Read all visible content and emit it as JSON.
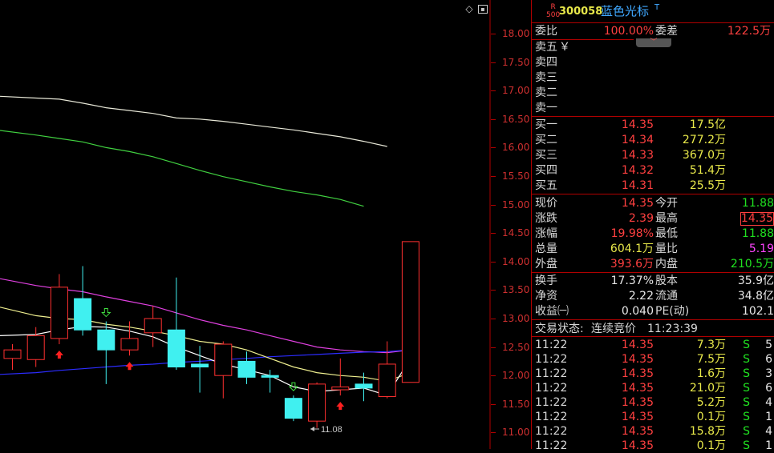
{
  "stock": {
    "badge_top": "R",
    "badge_bottom": "500",
    "code": "300058",
    "name": "蓝色光标",
    "flag": "T"
  },
  "commission": {
    "ratio_label": "委比",
    "ratio_value": "100.00%",
    "diff_label": "委差",
    "diff_value": "122.5万"
  },
  "sell": [
    {
      "label": "卖五",
      "extra": "￥"
    },
    {
      "label": "卖四"
    },
    {
      "label": "卖三"
    },
    {
      "label": "卖二"
    },
    {
      "label": "卖一"
    }
  ],
  "buy": [
    {
      "label": "买一",
      "price": "14.35",
      "volume": "17.5亿"
    },
    {
      "label": "买二",
      "price": "14.34",
      "volume": "277.2万"
    },
    {
      "label": "买三",
      "price": "14.33",
      "volume": "367.0万"
    },
    {
      "label": "买四",
      "price": "14.32",
      "volume": "51.4万"
    },
    {
      "label": "买五",
      "price": "14.31",
      "volume": "25.5万"
    }
  ],
  "quote": {
    "price_label": "现价",
    "price": "14.35",
    "open_label": "今开",
    "open": "11.88",
    "change_label": "涨跌",
    "change": "2.39",
    "high_label": "最高",
    "high": "14.35",
    "pct_label": "涨幅",
    "pct": "19.98%",
    "low_label": "最低",
    "low": "11.88",
    "vol_label": "总量",
    "vol": "604.1万",
    "qr_label": "量比",
    "qr": "5.19",
    "outer_label": "外盘",
    "outer": "393.6万",
    "inner_label": "内盘",
    "inner": "210.5万"
  },
  "fund": {
    "turnover_label": "换手",
    "turnover": "17.37%",
    "equity_label": "股本",
    "equity": "35.9亿",
    "nav_label": "净资",
    "nav": "2.22",
    "float_label": "流通",
    "float": "34.8亿",
    "eps_label": "收益㈠",
    "eps": "0.040",
    "pe_label": "PE(动)",
    "pe": "102.1"
  },
  "status": {
    "label": "交易状态:",
    "value": "连续竞价",
    "time": "11:23:39"
  },
  "ticks": [
    {
      "time": "11:22",
      "price": "14.35",
      "vol": "7.3万",
      "side": "S",
      "n": "5"
    },
    {
      "time": "11:22",
      "price": "14.35",
      "vol": "7.5万",
      "side": "S",
      "n": "6"
    },
    {
      "time": "11:22",
      "price": "14.35",
      "vol": "1.6万",
      "side": "S",
      "n": "3"
    },
    {
      "time": "11:22",
      "price": "14.35",
      "vol": "21.0万",
      "side": "S",
      "n": "6"
    },
    {
      "time": "11:22",
      "price": "14.35",
      "vol": "5.2万",
      "side": "S",
      "n": "4"
    },
    {
      "time": "11:22",
      "price": "14.35",
      "vol": "0.1万",
      "side": "S",
      "n": "1"
    },
    {
      "time": "11:22",
      "price": "14.35",
      "vol": "15.8万",
      "side": "S",
      "n": "4"
    },
    {
      "time": "11:22",
      "price": "14.35",
      "vol": "0.1万",
      "side": "S",
      "n": "1"
    }
  ],
  "chart_data": {
    "type": "candlestick",
    "yticks": [
      "18.00",
      "17.50",
      "17.00",
      "16.50",
      "16.00",
      "15.50",
      "15.00",
      "14.50",
      "14.00",
      "13.50",
      "13.00",
      "12.50",
      "12.00",
      "11.50",
      "11.00"
    ],
    "ylim": [
      10.9,
      18.3
    ],
    "low_marker": "11.08",
    "candles": [
      {
        "o": 12.3,
        "c": 12.45,
        "h": 12.55,
        "l": 12.1
      },
      {
        "o": 12.28,
        "c": 12.7,
        "h": 12.85,
        "l": 12.15
      },
      {
        "o": 12.65,
        "c": 13.55,
        "h": 13.78,
        "l": 12.55
      },
      {
        "o": 13.35,
        "c": 12.8,
        "h": 13.92,
        "l": 12.7
      },
      {
        "o": 12.8,
        "c": 12.45,
        "h": 12.95,
        "l": 11.85
      },
      {
        "o": 12.45,
        "c": 12.65,
        "h": 12.95,
        "l": 12.35
      },
      {
        "o": 12.75,
        "c": 13.0,
        "h": 13.22,
        "l": 12.5
      },
      {
        "o": 12.8,
        "c": 12.15,
        "h": 13.72,
        "l": 12.1
      },
      {
        "o": 12.2,
        "c": 12.15,
        "h": 12.52,
        "l": 11.7
      },
      {
        "o": 12.0,
        "c": 12.55,
        "h": 12.6,
        "l": 11.6
      },
      {
        "o": 12.25,
        "c": 11.97,
        "h": 12.42,
        "l": 11.85
      },
      {
        "o": 12.0,
        "c": 11.97,
        "h": 12.1,
        "l": 11.7
      },
      {
        "o": 11.6,
        "c": 11.25,
        "h": 11.65,
        "l": 11.2
      },
      {
        "o": 11.2,
        "c": 11.85,
        "h": 11.88,
        "l": 11.08
      },
      {
        "o": 11.75,
        "c": 11.8,
        "h": 12.3,
        "l": 11.65
      },
      {
        "o": 11.85,
        "c": 11.78,
        "h": 12.05,
        "l": 11.55
      },
      {
        "o": 11.63,
        "c": 12.2,
        "h": 12.6,
        "l": 11.6
      },
      {
        "o": 11.88,
        "c": 14.35,
        "h": 14.35,
        "l": 11.88
      }
    ],
    "series": [
      {
        "color": "#e8e8d8",
        "x": [
          0,
          1,
          2,
          3,
          4,
          5,
          6,
          7,
          8,
          9,
          10,
          11,
          12,
          13,
          14,
          15,
          16
        ],
        "y": [
          16.9,
          16.87,
          16.85,
          16.78,
          16.7,
          16.65,
          16.6,
          16.52,
          16.5,
          16.46,
          16.41,
          16.36,
          16.31,
          16.25,
          16.19,
          16.11,
          16.02
        ]
      },
      {
        "color": "#40d040",
        "x": [
          0,
          1,
          2,
          3,
          4,
          5,
          6,
          7,
          8,
          9,
          10,
          11,
          12,
          13,
          14,
          15
        ],
        "y": [
          16.3,
          16.22,
          16.16,
          16.1,
          16.0,
          15.93,
          15.84,
          15.72,
          15.6,
          15.49,
          15.4,
          15.31,
          15.23,
          15.17,
          15.09,
          14.97
        ]
      },
      {
        "color": "#e040e0",
        "x": [
          0,
          1,
          2,
          3,
          4,
          5,
          6,
          7,
          8,
          9,
          10,
          11,
          12,
          13,
          14,
          15,
          16,
          17
        ],
        "y": [
          13.7,
          13.58,
          13.52,
          13.47,
          13.38,
          13.3,
          13.22,
          13.1,
          12.98,
          12.88,
          12.8,
          12.7,
          12.6,
          12.5,
          12.45,
          12.42,
          12.4,
          12.45
        ]
      },
      {
        "color": "#2c2cff",
        "x": [
          0,
          1,
          2,
          3,
          4,
          5,
          6,
          7,
          8,
          9,
          10,
          11,
          12,
          13,
          14,
          15,
          16,
          17
        ],
        "y": [
          12.02,
          12.05,
          12.09,
          12.12,
          12.15,
          12.18,
          12.2,
          12.23,
          12.25,
          12.28,
          12.3,
          12.33,
          12.35,
          12.37,
          12.39,
          12.41,
          12.42,
          12.45
        ]
      },
      {
        "color": "#f0f090",
        "x": [
          0,
          1,
          2,
          3,
          4,
          5,
          6,
          7,
          8,
          9,
          10,
          11,
          12,
          13,
          14,
          15,
          16,
          17
        ],
        "y": [
          13.2,
          13.05,
          13.0,
          12.98,
          12.9,
          12.85,
          12.78,
          12.7,
          12.6,
          12.55,
          12.45,
          12.3,
          12.15,
          12.05,
          12.0,
          11.97,
          11.9,
          12.05
        ]
      },
      {
        "color": "#ffffff",
        "x": [
          0,
          1,
          2,
          3,
          4,
          5,
          6,
          7,
          8,
          9,
          10,
          11,
          12,
          13,
          14,
          15,
          16,
          17
        ],
        "y": [
          12.7,
          12.72,
          12.8,
          12.86,
          12.85,
          12.78,
          12.68,
          12.5,
          12.35,
          12.2,
          12.1,
          12.0,
          11.8,
          11.72,
          11.75,
          11.78,
          11.65,
          12.3
        ]
      }
    ],
    "up_arrows": [
      2,
      5,
      14
    ],
    "down_arrows": [
      4,
      12
    ],
    "arrow_up_color": "#ff2020",
    "arrow_down_color": "#40e040"
  }
}
